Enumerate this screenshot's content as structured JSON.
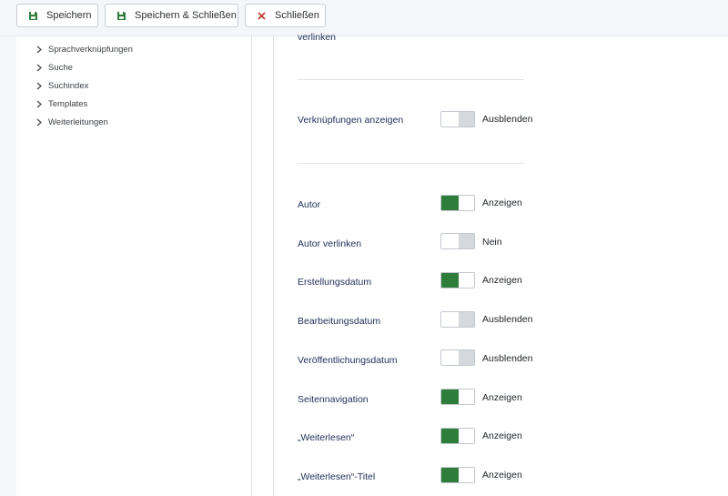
{
  "toolbar": {
    "save_label": "Speichern",
    "save_close_label": "Speichern & Schließen",
    "close_label": "Schließen",
    "save_icon_color": "#2f7d3b",
    "close_icon_color": "#c0392b"
  },
  "sidebar": {
    "items": [
      {
        "label": "Sprachverknüpfungen"
      },
      {
        "label": "Suche"
      },
      {
        "label": "Suchindex"
      },
      {
        "label": "Templates"
      },
      {
        "label": "Weiterleitungen"
      }
    ]
  },
  "main": {
    "top_label": "verlinken",
    "links_row": {
      "label": "Verknüpfungen anzeigen",
      "state": "Ausblenden",
      "on": false
    },
    "rows": [
      {
        "label": "Autor",
        "state": "Anzeigen",
        "on": true
      },
      {
        "label": "Autor verlinken",
        "state": "Nein",
        "on": false
      },
      {
        "label": "Erstellungsdatum",
        "state": "Anzeigen",
        "on": true
      },
      {
        "label": "Bearbeitungsdatum",
        "state": "Ausblenden",
        "on": false
      },
      {
        "label": "Veröffentlichungsdatum",
        "state": "Ausblenden",
        "on": false
      },
      {
        "label": "Seitennavigation",
        "state": "Anzeigen",
        "on": true
      },
      {
        "label": "„Weiterlesen“",
        "state": "Anzeigen",
        "on": true
      },
      {
        "label": "„Weiterlesen“-Titel",
        "state": "Anzeigen",
        "on": true
      }
    ],
    "toggle_on_color": "#2f7d3b",
    "toggle_off_color": "#d5d8dc"
  }
}
